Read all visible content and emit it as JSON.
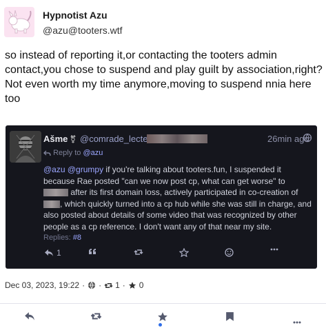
{
  "post": {
    "display_name": "Hypnotist Azu",
    "handle": "@azu@tooters.wtf",
    "text": "so instead of reporting it,or contacting the tooters admin contact,you chose to suspend and play guilt by association,right? Not even worth my time anymore,moving to suspend nnia here too",
    "date": "Dec 03, 2023, 19:22",
    "boost_count": "1",
    "fav_count": "0"
  },
  "quote": {
    "display_name": "Ašme",
    "flag": "⚧",
    "handle": "@comrade_lecter",
    "time": "26min ago",
    "reply_to_label": "Reply to",
    "reply_to_handle": "@azu",
    "mention1": "@azu",
    "mention2": "@grumpy",
    "body_part1": " if you're talking about tooters.fun, I suspended it because Rae posted \"can we now post cp, what can get worse\" to ",
    "body_part2": " after its first domain loss, actively participated in co-creation of ",
    "body_part3": ", which quickly turned into a cp hub while she was still in charge, and also posted about details of some video that was recognized by other people as a cp reference. I don't want any of that near my site.",
    "replies_label": "Replies:",
    "replies_num": "#8",
    "reply_count": "1"
  },
  "colors": {
    "quote_bg": "#15161d",
    "mention": "#9ba6ff",
    "active_star": "#2f6ee8"
  },
  "icons": [
    "reply-icon",
    "boost-icon",
    "star-icon",
    "bookmark-icon",
    "more-icon",
    "globe-icon",
    "quote-icon",
    "emoji-icon"
  ]
}
